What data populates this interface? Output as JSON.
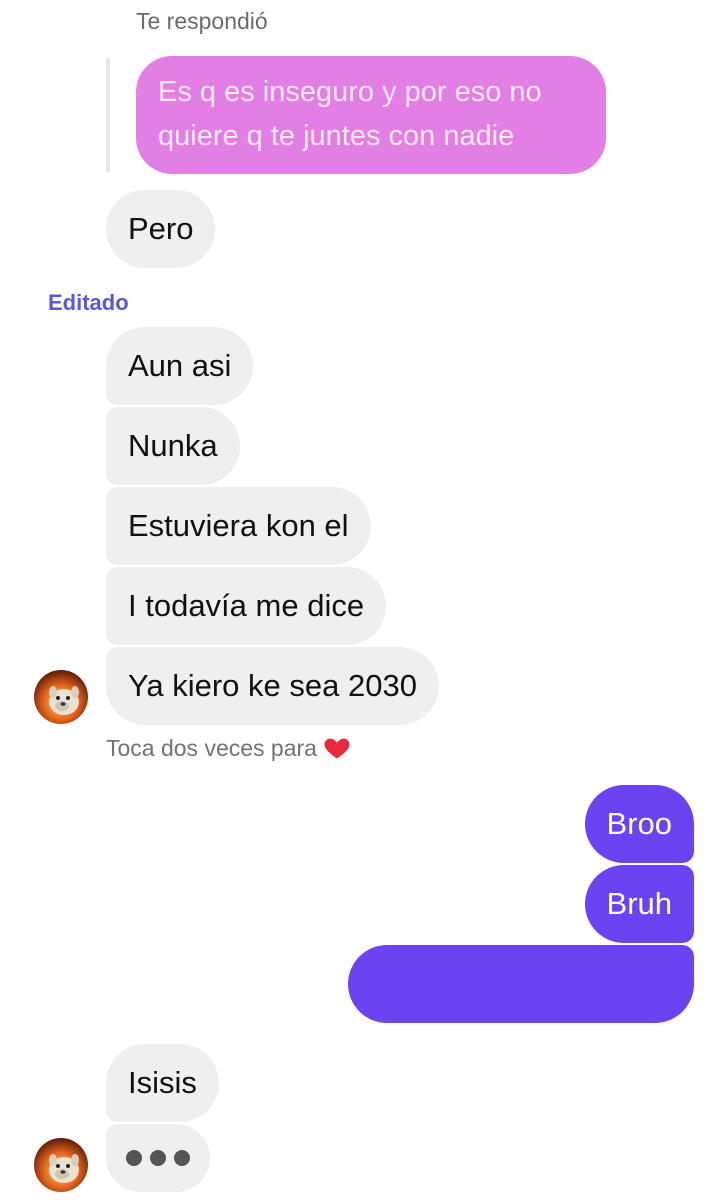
{
  "reply": {
    "label": "Te respondió",
    "quoted_text": "Es q es inseguro y por eso no\nquiere q te juntes con nadie"
  },
  "edited_label": "Editado",
  "incoming_group_1": [
    "Pero"
  ],
  "incoming_group_2": [
    "Aun asi",
    "Nunka",
    "Estuviera kon el",
    "I todavía me dice",
    "Ya kiero ke sea 2030"
  ],
  "double_tap_hint": "Toca dos veces para",
  "outgoing": [
    "Broo",
    "Bruh",
    ""
  ],
  "incoming_group_3": [
    "Isisis"
  ],
  "icons": {
    "heart": "heart-icon",
    "avatar": "avatar-image",
    "typing": "typing-indicator"
  },
  "colors": {
    "reply_bubble": "#e27ee4",
    "incoming_bubble": "#efefef",
    "outgoing_bubble": "#6b43f0",
    "edited_label": "#5b55e0",
    "heart": "#e8283c"
  }
}
